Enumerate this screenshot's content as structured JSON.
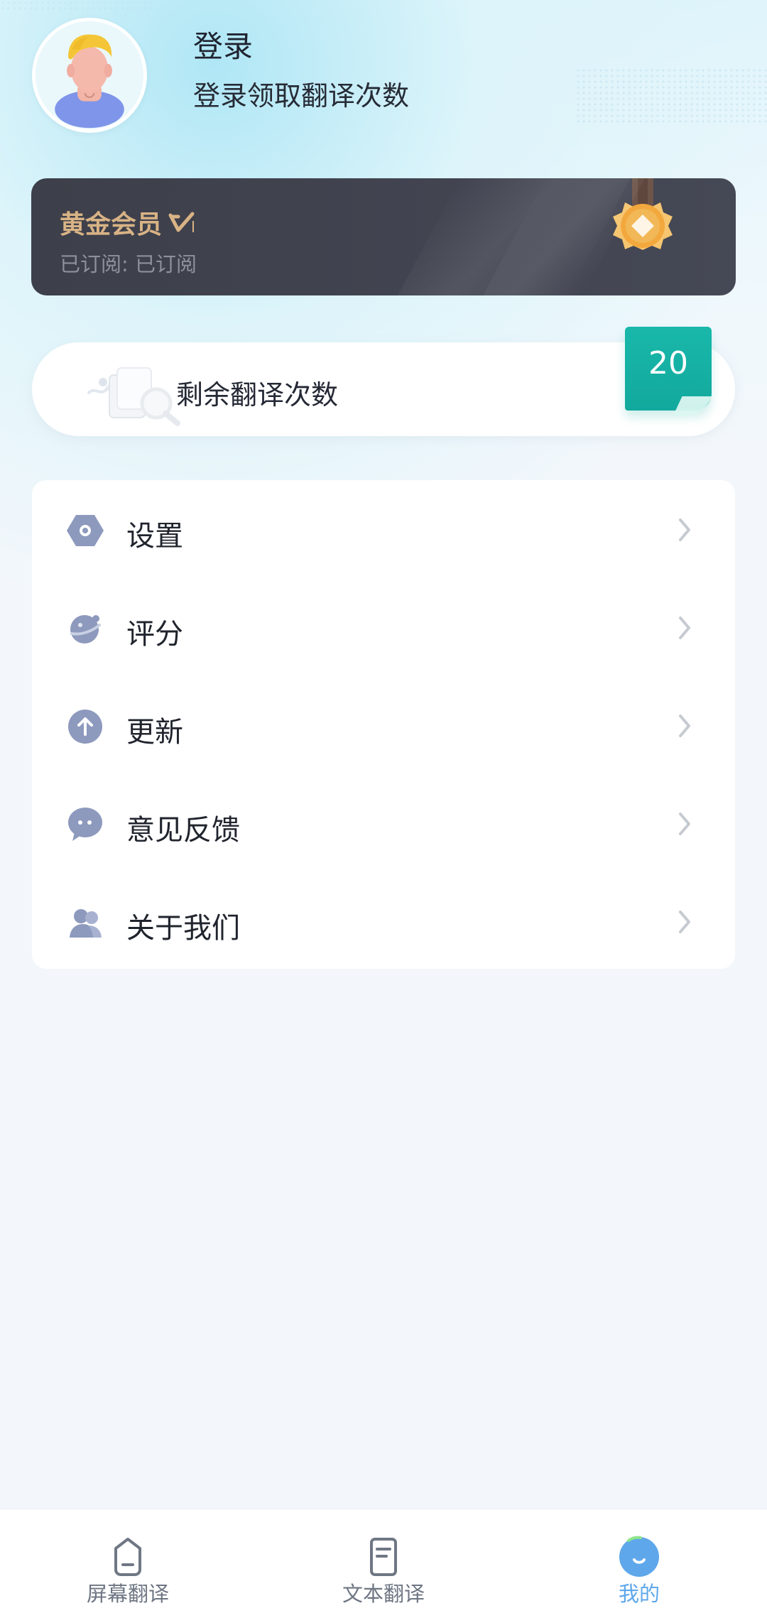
{
  "header": {
    "title": "登录",
    "subtitle": "登录领取翻译次数"
  },
  "member": {
    "title": "黄金会员",
    "status": "已订阅: 已订阅"
  },
  "translation": {
    "label": "剩余翻译次数",
    "count": "20"
  },
  "menu": {
    "items": [
      {
        "label": "设置",
        "icon": "settings-icon"
      },
      {
        "label": "评分",
        "icon": "rating-icon"
      },
      {
        "label": "更新",
        "icon": "update-icon"
      },
      {
        "label": "意见反馈",
        "icon": "feedback-icon"
      },
      {
        "label": "关于我们",
        "icon": "about-icon"
      }
    ]
  },
  "bottom_nav": {
    "items": [
      {
        "label": "屏幕翻译",
        "icon": "screen-translate-icon",
        "active": false
      },
      {
        "label": "文本翻译",
        "icon": "text-translate-icon",
        "active": false
      },
      {
        "label": "我的",
        "icon": "profile-tab-icon",
        "active": true
      }
    ]
  },
  "colors": {
    "background": "#f3f7fb",
    "member_card": "#424551",
    "member_gold": "#d8b385",
    "badge_green": "#14ad9f",
    "menu_icon": "#8a97bb",
    "active_nav": "#5ea7ea"
  }
}
